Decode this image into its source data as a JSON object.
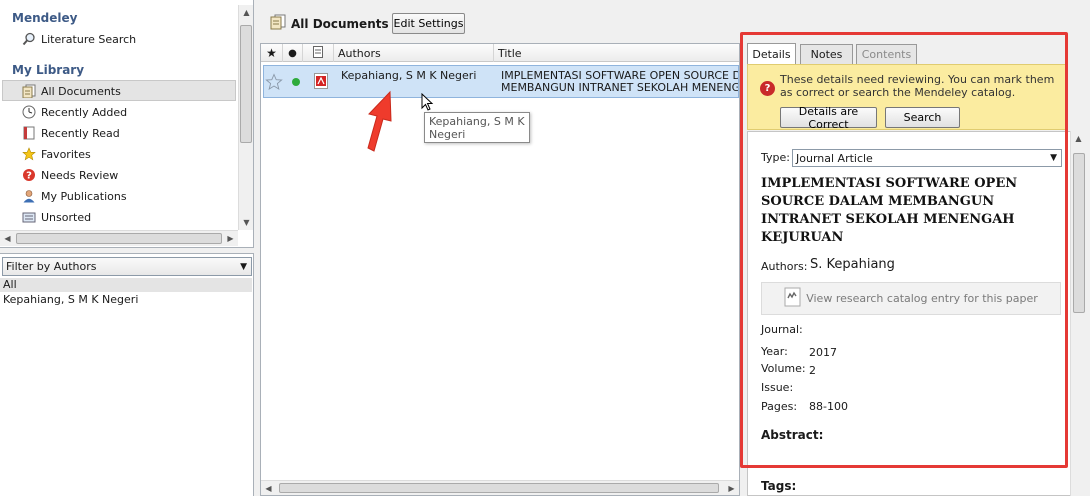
{
  "sidebar": {
    "mendeley_header": "Mendeley",
    "literature_search": "Literature Search",
    "my_library_header": "My Library",
    "items": [
      {
        "label": "All Documents",
        "icon": "documents-icon"
      },
      {
        "label": "Recently Added",
        "icon": "clock-icon"
      },
      {
        "label": "Recently Read",
        "icon": "book-icon"
      },
      {
        "label": "Favorites",
        "icon": "star-icon"
      },
      {
        "label": "Needs Review",
        "icon": "question-icon"
      },
      {
        "label": "My Publications",
        "icon": "person-icon"
      },
      {
        "label": "Unsorted",
        "icon": "tray-icon"
      }
    ]
  },
  "filter": {
    "selected": "Filter by Authors",
    "all": "All",
    "authors": [
      "Kepahiang, S M K Negeri"
    ]
  },
  "toolbar": {
    "title": "All Documents",
    "edit_settings": "Edit Settings"
  },
  "list": {
    "headers": {
      "authors": "Authors",
      "title": "Title"
    },
    "row": {
      "authors": "Kepahiang, S M K Negeri",
      "title_line1": "IMPLEMENTASI SOFTWARE OPEN SOURCE DALAM",
      "title_line2": "MEMBANGUN INTRANET SEKOLAH MENENGAH KEJ"
    },
    "tooltip_line1": "Kepahiang, S M K",
    "tooltip_line2": "Negeri"
  },
  "details": {
    "tabs": [
      "Details",
      "Notes",
      "Contents"
    ],
    "review_message": "These details need reviewing. You can mark them as correct or search the Mendeley catalog.",
    "correct_button": "Details are Correct",
    "search_button": "Search",
    "type_label": "Type:",
    "type_value": "Journal Article",
    "title": "IMPLEMENTASI SOFTWARE OPEN SOURCE DALAM MEMBANGUN INTRANET SEKOLAH MENENGAH KEJURUAN",
    "authors_label": "Authors:",
    "authors_value": "S. Kepahiang",
    "catalog_link": "View research catalog entry for this paper",
    "journal_label": "Journal:",
    "year_label": "Year:",
    "year_value": "2017",
    "volume_label": "Volume:",
    "volume_value": "2",
    "issue_label": "Issue:",
    "pages_label": "Pages:",
    "pages_value": "88-100",
    "abstract_label": "Abstract:",
    "tags_label": "Tags:"
  },
  "colors": {
    "selection": "#cfe3f7",
    "banner": "#fbeca0",
    "highlight_frame": "#e53935",
    "arrow": "#ef3b2c"
  }
}
